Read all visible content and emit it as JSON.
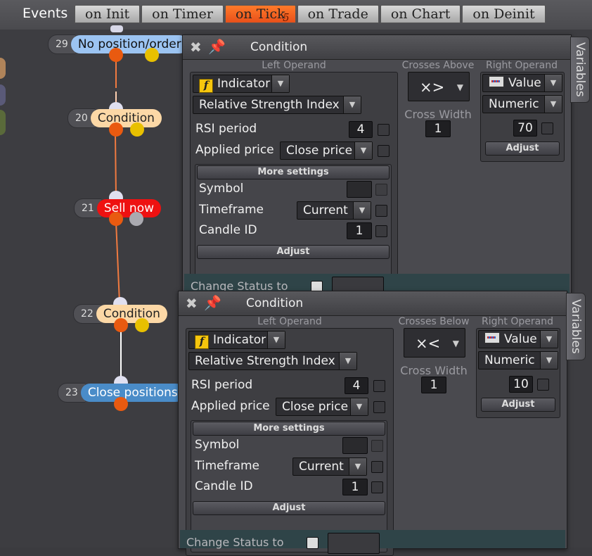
{
  "topbar": {
    "events_label": "Events",
    "tabs": [
      {
        "label": "on Init"
      },
      {
        "label": "on Timer"
      },
      {
        "label": "on Tick",
        "badge": "5"
      },
      {
        "label": "on Trade"
      },
      {
        "label": "on Chart"
      },
      {
        "label": "on Deinit"
      }
    ]
  },
  "nodes": [
    {
      "num": "29",
      "label": "No position/order"
    },
    {
      "num": "20",
      "label": "Condition"
    },
    {
      "num": "21",
      "label": "Sell now"
    },
    {
      "num": "22",
      "label": "Condition"
    },
    {
      "num": "23",
      "label": "Close positions"
    }
  ],
  "colors": {
    "tab_active": "#e8501a",
    "node_condition": "#fcd8a6",
    "node_sell": "#ee1111",
    "node_close": "#4a8cc8",
    "node_nopos": "#9cc4f2",
    "dot_orange": "#e95a10",
    "dot_yellow": "#e8c000"
  },
  "dialogs": [
    {
      "title": "Condition",
      "variables_tab": "Variables",
      "left_operand": {
        "caption": "Left Operand",
        "type_value": "Indicator",
        "indicator_value": "Relative Strength Index",
        "rsi_period_label": "RSI period",
        "rsi_period_value": "4",
        "applied_price_label": "Applied price",
        "applied_price_value": "Close price",
        "more_settings_label": "More settings",
        "symbol_label": "Symbol",
        "timeframe_label": "Timeframe",
        "timeframe_value": "Current",
        "candle_id_label": "Candle ID",
        "candle_id_value": "1",
        "adjust_label": "Adjust"
      },
      "operator": {
        "caption": "Crosses Above",
        "value": "×>",
        "cross_width_label": "Cross Width",
        "cross_width_value": "1"
      },
      "right_operand": {
        "caption": "Right Operand",
        "type_value": "Value",
        "numeric_value": "Numeric",
        "value": "70",
        "adjust_label": "Adjust"
      },
      "change_status_label": "Change Status to"
    },
    {
      "title": "Condition",
      "variables_tab": "Variables",
      "left_operand": {
        "caption": "Left Operand",
        "type_value": "Indicator",
        "indicator_value": "Relative Strength Index",
        "rsi_period_label": "RSI period",
        "rsi_period_value": "4",
        "applied_price_label": "Applied price",
        "applied_price_value": "Close price",
        "more_settings_label": "More settings",
        "symbol_label": "Symbol",
        "timeframe_label": "Timeframe",
        "timeframe_value": "Current",
        "candle_id_label": "Candle ID",
        "candle_id_value": "1",
        "adjust_label": "Adjust"
      },
      "operator": {
        "caption": "Crosses Below",
        "value": "×<",
        "cross_width_label": "Cross Width",
        "cross_width_value": "1"
      },
      "right_operand": {
        "caption": "Right Operand",
        "type_value": "Value",
        "numeric_value": "Numeric",
        "value": "10",
        "adjust_label": "Adjust"
      },
      "change_status_label": "Change Status to"
    }
  ]
}
